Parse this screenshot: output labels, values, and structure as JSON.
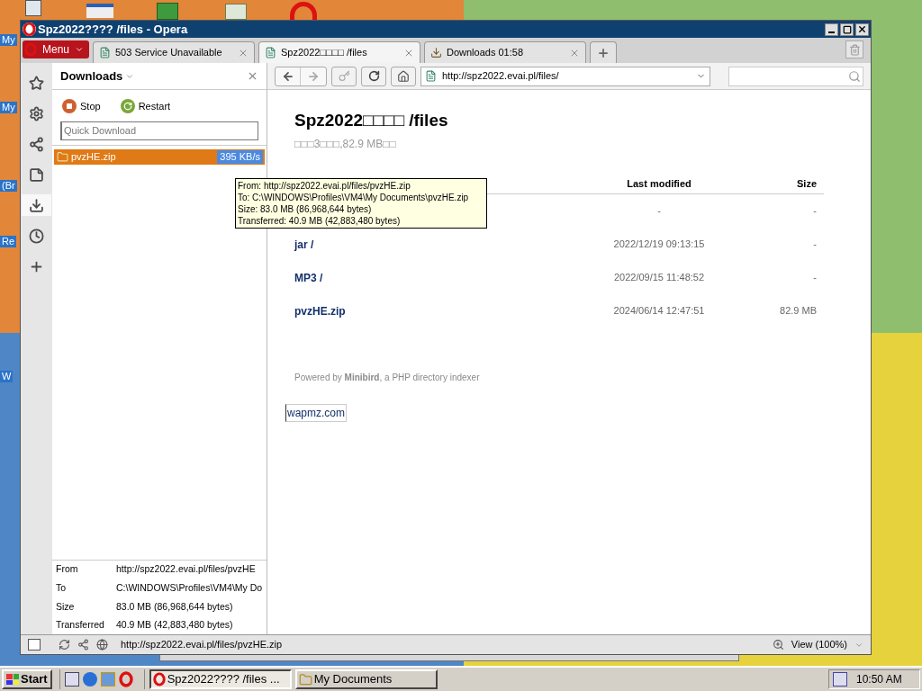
{
  "desktop": {
    "icon_labels": [
      "My",
      "My",
      "(Br",
      "Re",
      "W"
    ]
  },
  "window": {
    "title": "Spz2022???? /files - Opera"
  },
  "menu_button": "Menu",
  "tabs": [
    {
      "label": "503 Service Unavailable",
      "selected": false,
      "kind": "page"
    },
    {
      "label": "Spz2022□□□□ /files",
      "selected": true,
      "kind": "page"
    },
    {
      "label": "Downloads 01:58",
      "selected": false,
      "kind": "downloads"
    }
  ],
  "address_bar": {
    "url": "http://spz2022.evai.pl/files/"
  },
  "sidebar": {
    "items": [
      {
        "kind": "bookmarks",
        "selected": false
      },
      {
        "kind": "settings",
        "selected": false
      },
      {
        "kind": "unite",
        "selected": false
      },
      {
        "kind": "notes",
        "selected": false
      },
      {
        "kind": "downloads",
        "selected": true
      },
      {
        "kind": "history",
        "selected": false
      },
      {
        "kind": "add",
        "selected": false
      }
    ]
  },
  "downloads_panel": {
    "title": "Downloads",
    "actions": [
      {
        "kind": "stop",
        "label": "Stop"
      },
      {
        "kind": "restart",
        "label": "Restart"
      }
    ],
    "quick_download": {
      "placeholder": "Quick Download"
    },
    "items": [
      {
        "name": "pvzHE.zip",
        "speed": "395 KB/s",
        "selected": true
      }
    ],
    "details": [
      {
        "label": "From",
        "value": "http://spz2022.evai.pl/files/pvzHE"
      },
      {
        "label": "To",
        "value": "C:\\WINDOWS\\Profiles\\VM4\\My Do"
      },
      {
        "label": "Size",
        "value": "83.0 MB (86,968,644 bytes)"
      },
      {
        "label": "Transferred",
        "value": "40.9 MB (42,883,480 bytes)"
      }
    ]
  },
  "tooltip": {
    "lines": [
      "From: http://spz2022.evai.pl/files/pvzHE.zip",
      "To: C:\\WINDOWS\\Profiles\\VM4\\My Documents\\pvzHE.zip",
      "Size: 83.0 MB (86,968,644 bytes)",
      "Transferred: 40.9 MB (42,883,480 bytes)"
    ]
  },
  "page": {
    "heading": "Spz2022□□□□ /files",
    "summary": "□□□3□□□,82.9 MB□□",
    "columns": [
      "Last modified",
      "Size"
    ],
    "rows": [
      {
        "modified": "-",
        "size": "-"
      },
      {
        "name": "jar /",
        "modified": "2022/12/19 09:13:15",
        "size": "-"
      },
      {
        "name": "MP3 /",
        "modified": "2022/09/15 11:48:52",
        "size": "-"
      },
      {
        "name": "pvzHE.zip",
        "modified": "2024/06/14 12:47:51",
        "size": "82.9 MB"
      }
    ],
    "footer": "Powered by **Minibird**, a PHP directory indexer",
    "link": "wapmz.com"
  },
  "status_bar": {
    "url": "http://spz2022.evai.pl/files/pvzHE.zip",
    "zoom": "View (100%)"
  },
  "taskbar": {
    "start": "Start",
    "tasks": [
      {
        "label": "Spz2022???? /files ...",
        "selected": true,
        "kind": "opera"
      },
      {
        "label": "My Documents",
        "selected": false,
        "kind": "folder"
      }
    ],
    "clock": "10:50 AM"
  }
}
